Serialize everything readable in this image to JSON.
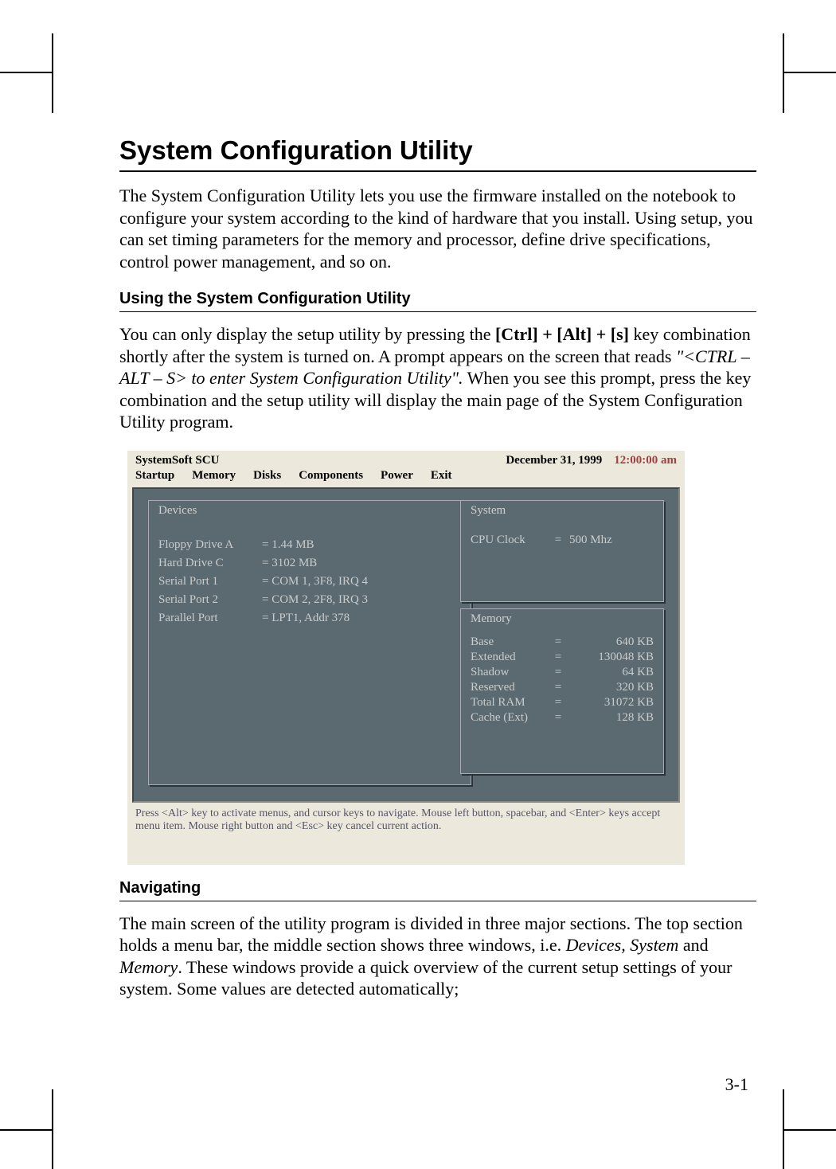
{
  "heading": "System Configuration Utility",
  "intro": "The System Configuration Utility lets you use the firmware installed on the notebook to configure your system according to the kind of hardware that you install. Using setup, you can set timing parameters for the memory and processor, define drive specifications, control power management, and so on.",
  "section1_title": "Using the System Configuration Utility",
  "section1_p_before_bold": "You can only display the setup utility by pressing the ",
  "section1_bold": "[Ctrl] + [Alt] + [s]",
  "section1_p_mid": " key combination shortly after the system is turned on. A prompt appears on the screen that reads ",
  "section1_italic": "\"<CTRL – ALT – S> to enter System Configuration Utility\".",
  "section1_p_after": " When you see this prompt, press the key combination and the setup utility will display the main page of the System Configuration Utility program.",
  "scu": {
    "title": "SystemSoft SCU",
    "date": "December 31, 1999",
    "time": "12:00:00 am",
    "menu": [
      "Startup",
      "Memory",
      "Disks",
      "Components",
      "Power",
      "Exit"
    ],
    "devices_title": "Devices",
    "devices": [
      {
        "label": "Floppy Drive A",
        "value": "=  1.44  MB"
      },
      {
        "label": "Hard Drive C",
        "value": "=  3102  MB"
      },
      {
        "label": "Serial Port 1",
        "value": "=  COM 1,  3F8,  IRQ 4"
      },
      {
        "label": "Serial Port 2",
        "value": "=  COM 2,  2F8,  IRQ 3"
      },
      {
        "label": "Parallel Port",
        "value": "=  LPT1, Addr 378"
      }
    ],
    "system_title": "System",
    "system_rows": [
      {
        "label": "CPU Clock",
        "eq": "=",
        "value": "500  Mhz"
      }
    ],
    "memory_title": "Memory",
    "memory_rows": [
      {
        "label": "Base",
        "eq": "=",
        "value": "640  KB"
      },
      {
        "label": "Extended",
        "eq": "=",
        "value": "130048  KB"
      },
      {
        "label": "Shadow",
        "eq": "=",
        "value": "64  KB"
      },
      {
        "label": "Reserved",
        "eq": "=",
        "value": "320 KB"
      },
      {
        "label": "Total  RAM",
        "eq": "=",
        "value": "31072 KB"
      },
      {
        "label": "Cache  (Ext)",
        "eq": "=",
        "value": "128 KB"
      }
    ],
    "footer": "Press <Alt> key to activate menus, and cursor keys to navigate. Mouse left button, spacebar, and <Enter> keys accept menu item. Mouse right button and <Esc> key cancel current action."
  },
  "section2_title": "Navigating",
  "section2_p_a": "The main screen of the utility program is divided in three major sections. The top section holds a menu bar, the middle section shows three windows, i.e. ",
  "section2_italic1": "Devices, System",
  "section2_p_b": " and ",
  "section2_italic2": "Memory",
  "section2_p_c": ". These windows provide a quick overview of the current setup settings of your system. Some values are detected automatically;",
  "page_number": "3-1"
}
